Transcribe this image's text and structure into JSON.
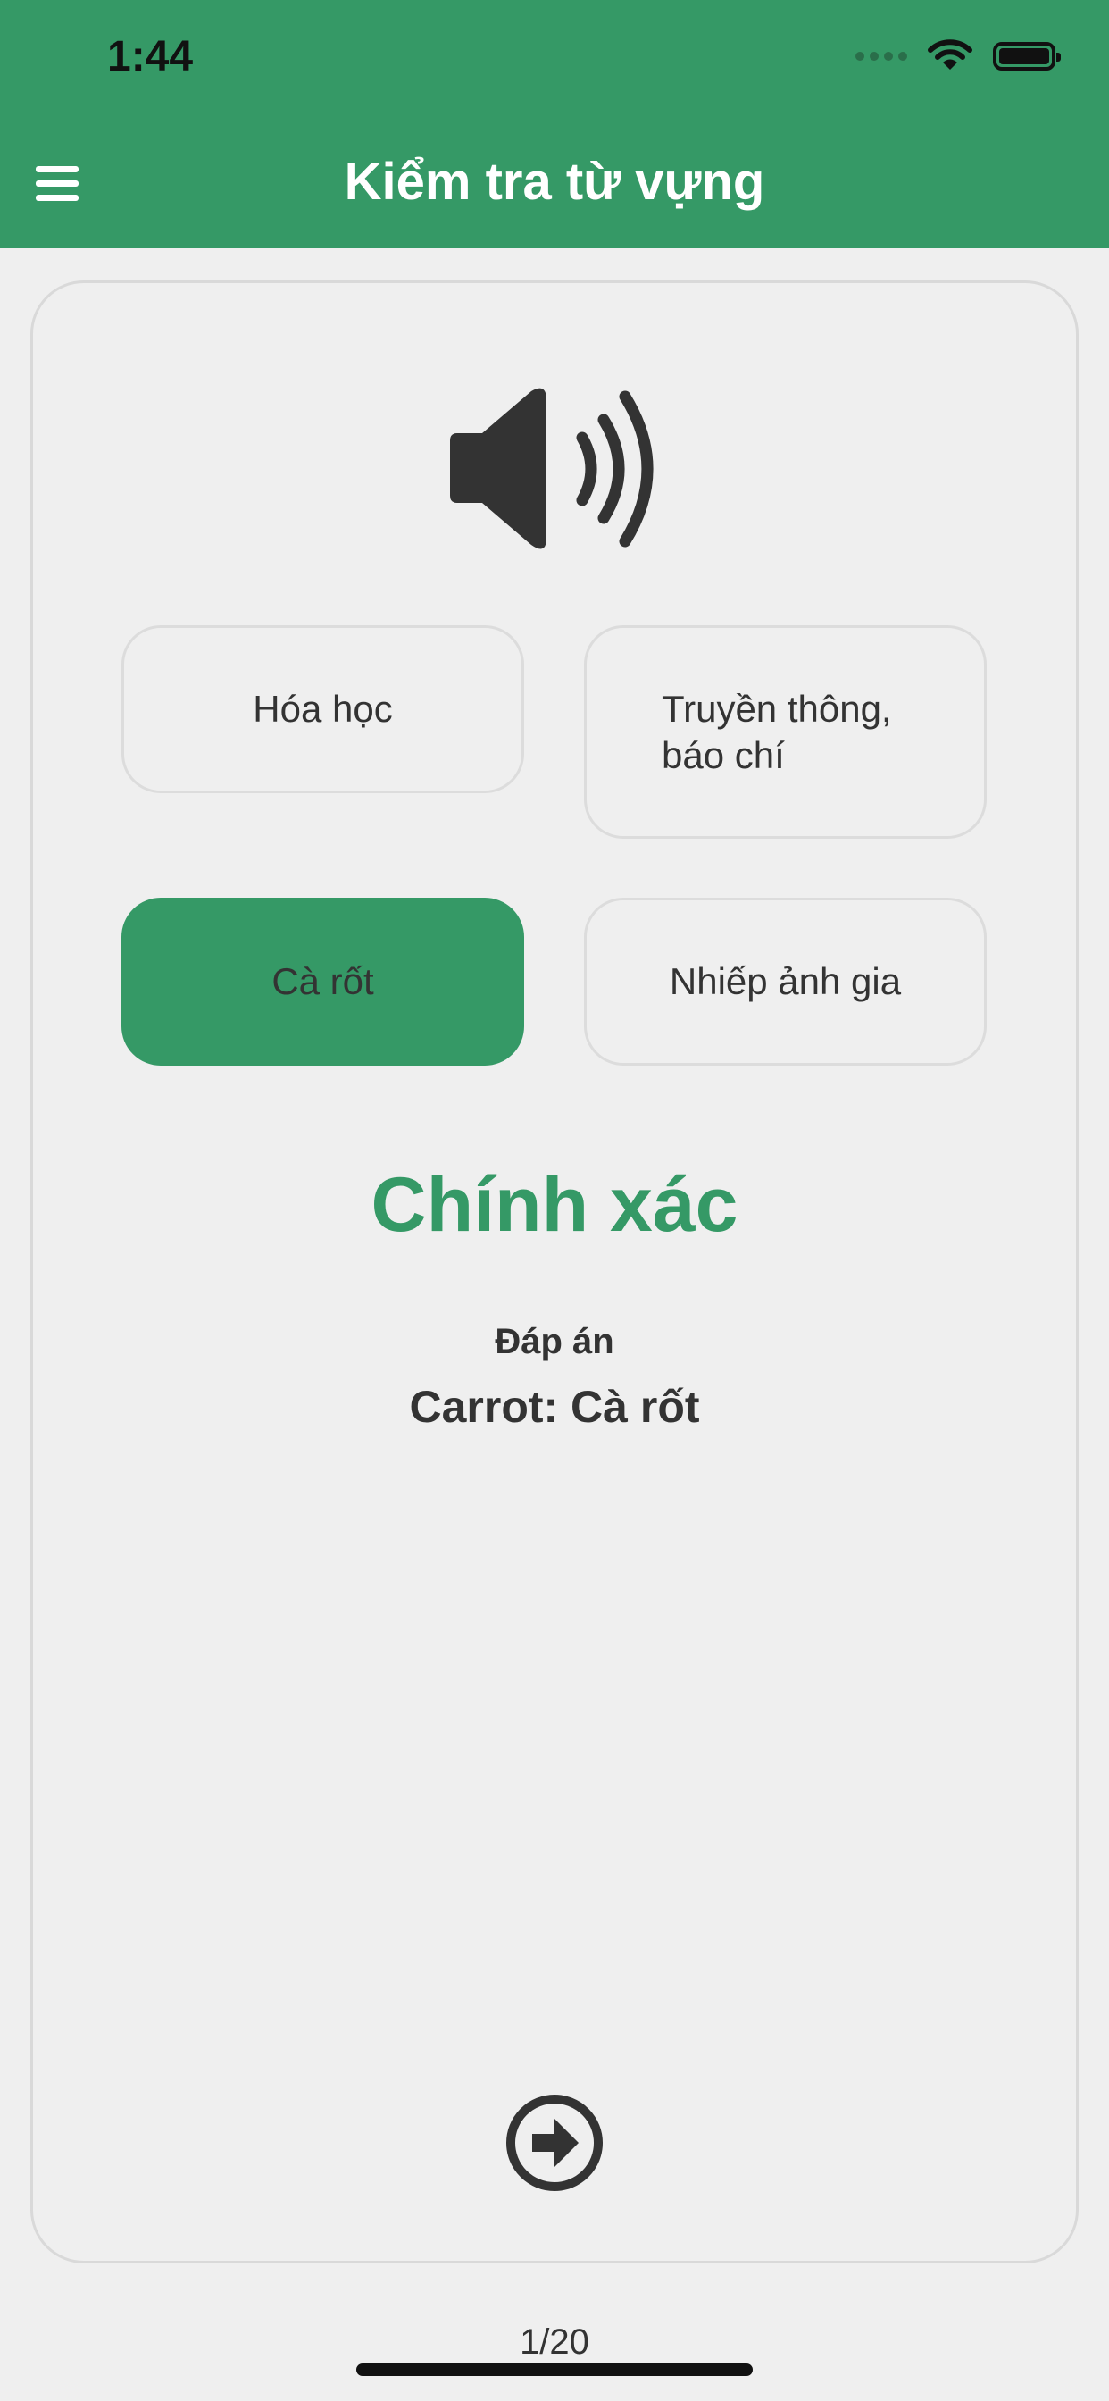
{
  "status_bar": {
    "time": "1:44",
    "icons": [
      "signal-dots-icon",
      "wifi-icon",
      "battery-icon"
    ]
  },
  "header": {
    "title": "Kiểm tra từ vựng",
    "menu_icon": "hamburger-menu-icon",
    "background_color": "#359966"
  },
  "quiz": {
    "speaker_icon": "speaker-volume-icon",
    "options": [
      {
        "label": "Hóa học",
        "selected": false
      },
      {
        "label": "Truyền thông, báo chí",
        "selected": false
      },
      {
        "label": "Cà rốt",
        "selected": true
      },
      {
        "label": "Nhiếp ảnh gia",
        "selected": false
      }
    ],
    "result": "Chính xác",
    "answer_label": "Đáp án",
    "answer": "Carrot: Cà rốt",
    "next_icon": "arrow-right-circle-icon",
    "progress": "1/20",
    "accent_color": "#359966"
  }
}
